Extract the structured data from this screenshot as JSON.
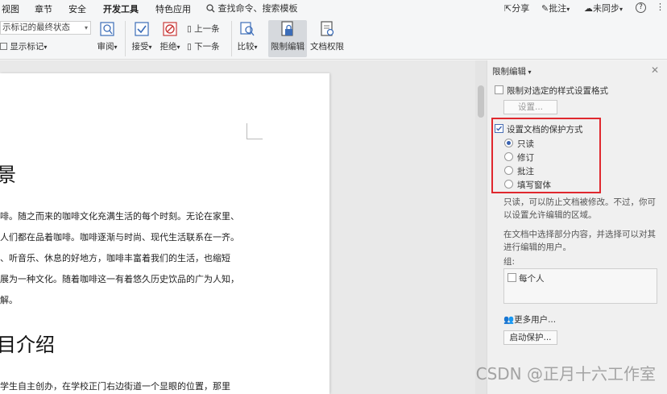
{
  "menu": {
    "items": [
      "视图",
      "章节",
      "安全",
      "开发工具",
      "特色应用"
    ],
    "active_index": 3,
    "search_placeholder": "查找命令、搜索模板",
    "share": "分享",
    "annotate": "批注",
    "sync": "未同步",
    "help": "?",
    "more": "⋮"
  },
  "ribbon": {
    "markup_state": "示标记的最终状态",
    "show_markup": "显示标记",
    "review": "审阅",
    "accept": "接受",
    "reject": "拒绝",
    "prev": "上一条",
    "next": "下一条",
    "compare": "比较",
    "restrict_edit": "限制编辑",
    "doc_permission": "文档权限"
  },
  "document": {
    "heading1": "景",
    "paragraph1": [
      "啡。随之而来的咖啡文化充满生活的每个时刻。无论在家里、",
      "人们都在品着咖啡。咖啡逐渐与时尚、现代生活联系在一齐。",
      "、听音乐、休息的好地方，咖啡丰富着我们的生活，也缩短",
      "展为一种文化。随着咖啡这一有着悠久历史饮品的广为人知，",
      "解。"
    ],
    "heading2": "目介绍",
    "paragraph2": [
      "学生自主创办，在学校正门右边街道一个显眼的位置，那里"
    ]
  },
  "panel": {
    "title": "限制编辑",
    "restrict_format_label": "限制对选定的样式设置格式",
    "settings_button": "设置...",
    "protection_label": "设置文档的保护方式",
    "options": [
      "只读",
      "修订",
      "批注",
      "填写窗体"
    ],
    "selected_option": 0,
    "readonly_desc": [
      "只读，可以防止文档被修改。不过，你可",
      "以设置允许编辑的区域。"
    ],
    "select_desc": [
      "在文档中选择部分内容，并选择可以对其",
      "进行编辑的用户。"
    ],
    "group_label": "组:",
    "everyone_label": "每个人",
    "more_users": "更多用户...",
    "start_protect_button": "启动保护..."
  },
  "watermark": "CSDN @正月十六工作室",
  "colors": {
    "highlight_border": "#e0282e",
    "radio_selected": "#3a62b0"
  }
}
